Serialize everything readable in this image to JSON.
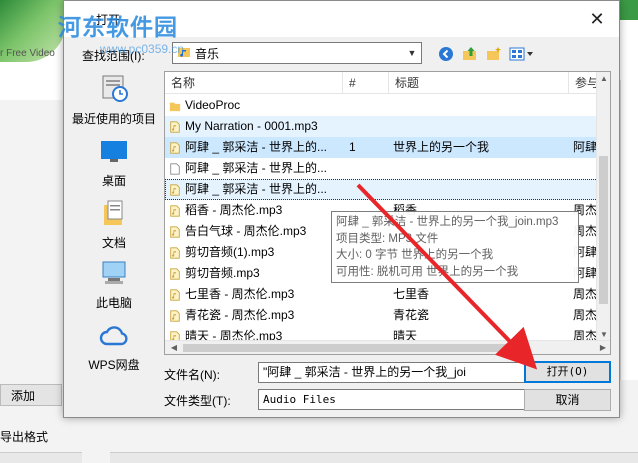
{
  "background": {
    "sidebar_fragment": "r Free Video",
    "add_button": "添加",
    "export_label": "导出格式"
  },
  "watermark": {
    "text": "河东软件园",
    "url": "www.pc0359.cn"
  },
  "dialog": {
    "title": "打开",
    "close_icon": "close-icon",
    "look_in": {
      "label": "查找范围(I):",
      "value": "音乐"
    },
    "toolbar": [
      "back-icon",
      "up-folder-icon",
      "new-folder-icon",
      "view-menu-icon"
    ],
    "places": [
      {
        "label": "最近使用的项目",
        "icon": "recent-icon"
      },
      {
        "label": "桌面",
        "icon": "desktop-icon"
      },
      {
        "label": "文档",
        "icon": "documents-icon"
      },
      {
        "label": "此电脑",
        "icon": "computer-icon"
      },
      {
        "label": "WPS网盘",
        "icon": "cloud-icon"
      }
    ],
    "columns": {
      "name": "名称",
      "num": "#",
      "title": "标题",
      "participant": "参与"
    },
    "files": [
      {
        "name": "VideoProc",
        "num": "",
        "title": "",
        "participant": "",
        "type": "folder",
        "state": ""
      },
      {
        "name": "My Narration - 0001.mp3",
        "num": "",
        "title": "",
        "participant": "",
        "type": "audio",
        "state": "hl"
      },
      {
        "name": "阿肆 _ 郭采洁 - 世界上的...",
        "num": "1",
        "title": "世界上的另一个我",
        "participant": "阿肆",
        "type": "audio",
        "state": "sel"
      },
      {
        "name": "阿肆 _ 郭采洁 - 世界上的...",
        "num": "",
        "title": "",
        "participant": "",
        "type": "doc",
        "state": ""
      },
      {
        "name": "阿肆 _ 郭采洁 - 世界上的...",
        "num": "",
        "title": "",
        "participant": "",
        "type": "audio",
        "state": "focus"
      },
      {
        "name": "稻香 - 周杰伦.mp3",
        "num": "",
        "title": "稻香",
        "participant": "周杰",
        "type": "audio",
        "state": ""
      },
      {
        "name": "告白气球 - 周杰伦.mp3",
        "num": "",
        "title": "",
        "participant": "周杰",
        "type": "audio",
        "state": ""
      },
      {
        "name": "剪切音频(1).mp3",
        "num": "",
        "title": "",
        "participant": "阿肆",
        "type": "audio",
        "state": ""
      },
      {
        "name": "剪切音频.mp3",
        "num": "",
        "title": "",
        "participant": "阿肆",
        "type": "audio",
        "state": ""
      },
      {
        "name": "七里香 - 周杰伦.mp3",
        "num": "",
        "title": "七里香",
        "participant": "周杰",
        "type": "audio",
        "state": ""
      },
      {
        "name": "青花瓷 - 周杰伦.mp3",
        "num": "",
        "title": "青花瓷",
        "participant": "周杰",
        "type": "audio",
        "state": ""
      },
      {
        "name": "晴天 - 周杰伦.mp3",
        "num": "",
        "title": "晴天",
        "participant": "周杰",
        "type": "audio",
        "state": ""
      }
    ],
    "tooltip": [
      "阿肆 _ 郭采洁 - 世界上的另一个我_join.mp3",
      "项目类型: MP3 文件",
      "大小: 0 字节 世界上的另一个我",
      "可用性: 脱机可用 世界上的另一个我"
    ],
    "filename": {
      "label": "文件名(N):",
      "value": "\"阿肆 _ 郭采洁 - 世界上的另一个我_joi"
    },
    "filetype": {
      "label": "文件类型(T):",
      "value": "Audio Files"
    },
    "buttons": {
      "open": "打开(O)",
      "cancel": "取消"
    }
  },
  "colors": {
    "selection": "#cce8ff",
    "hover": "#e5f3ff",
    "focus_border": "#0078d7",
    "watermark": "#2c8be0",
    "annotation_arrow": "#e8262a"
  }
}
